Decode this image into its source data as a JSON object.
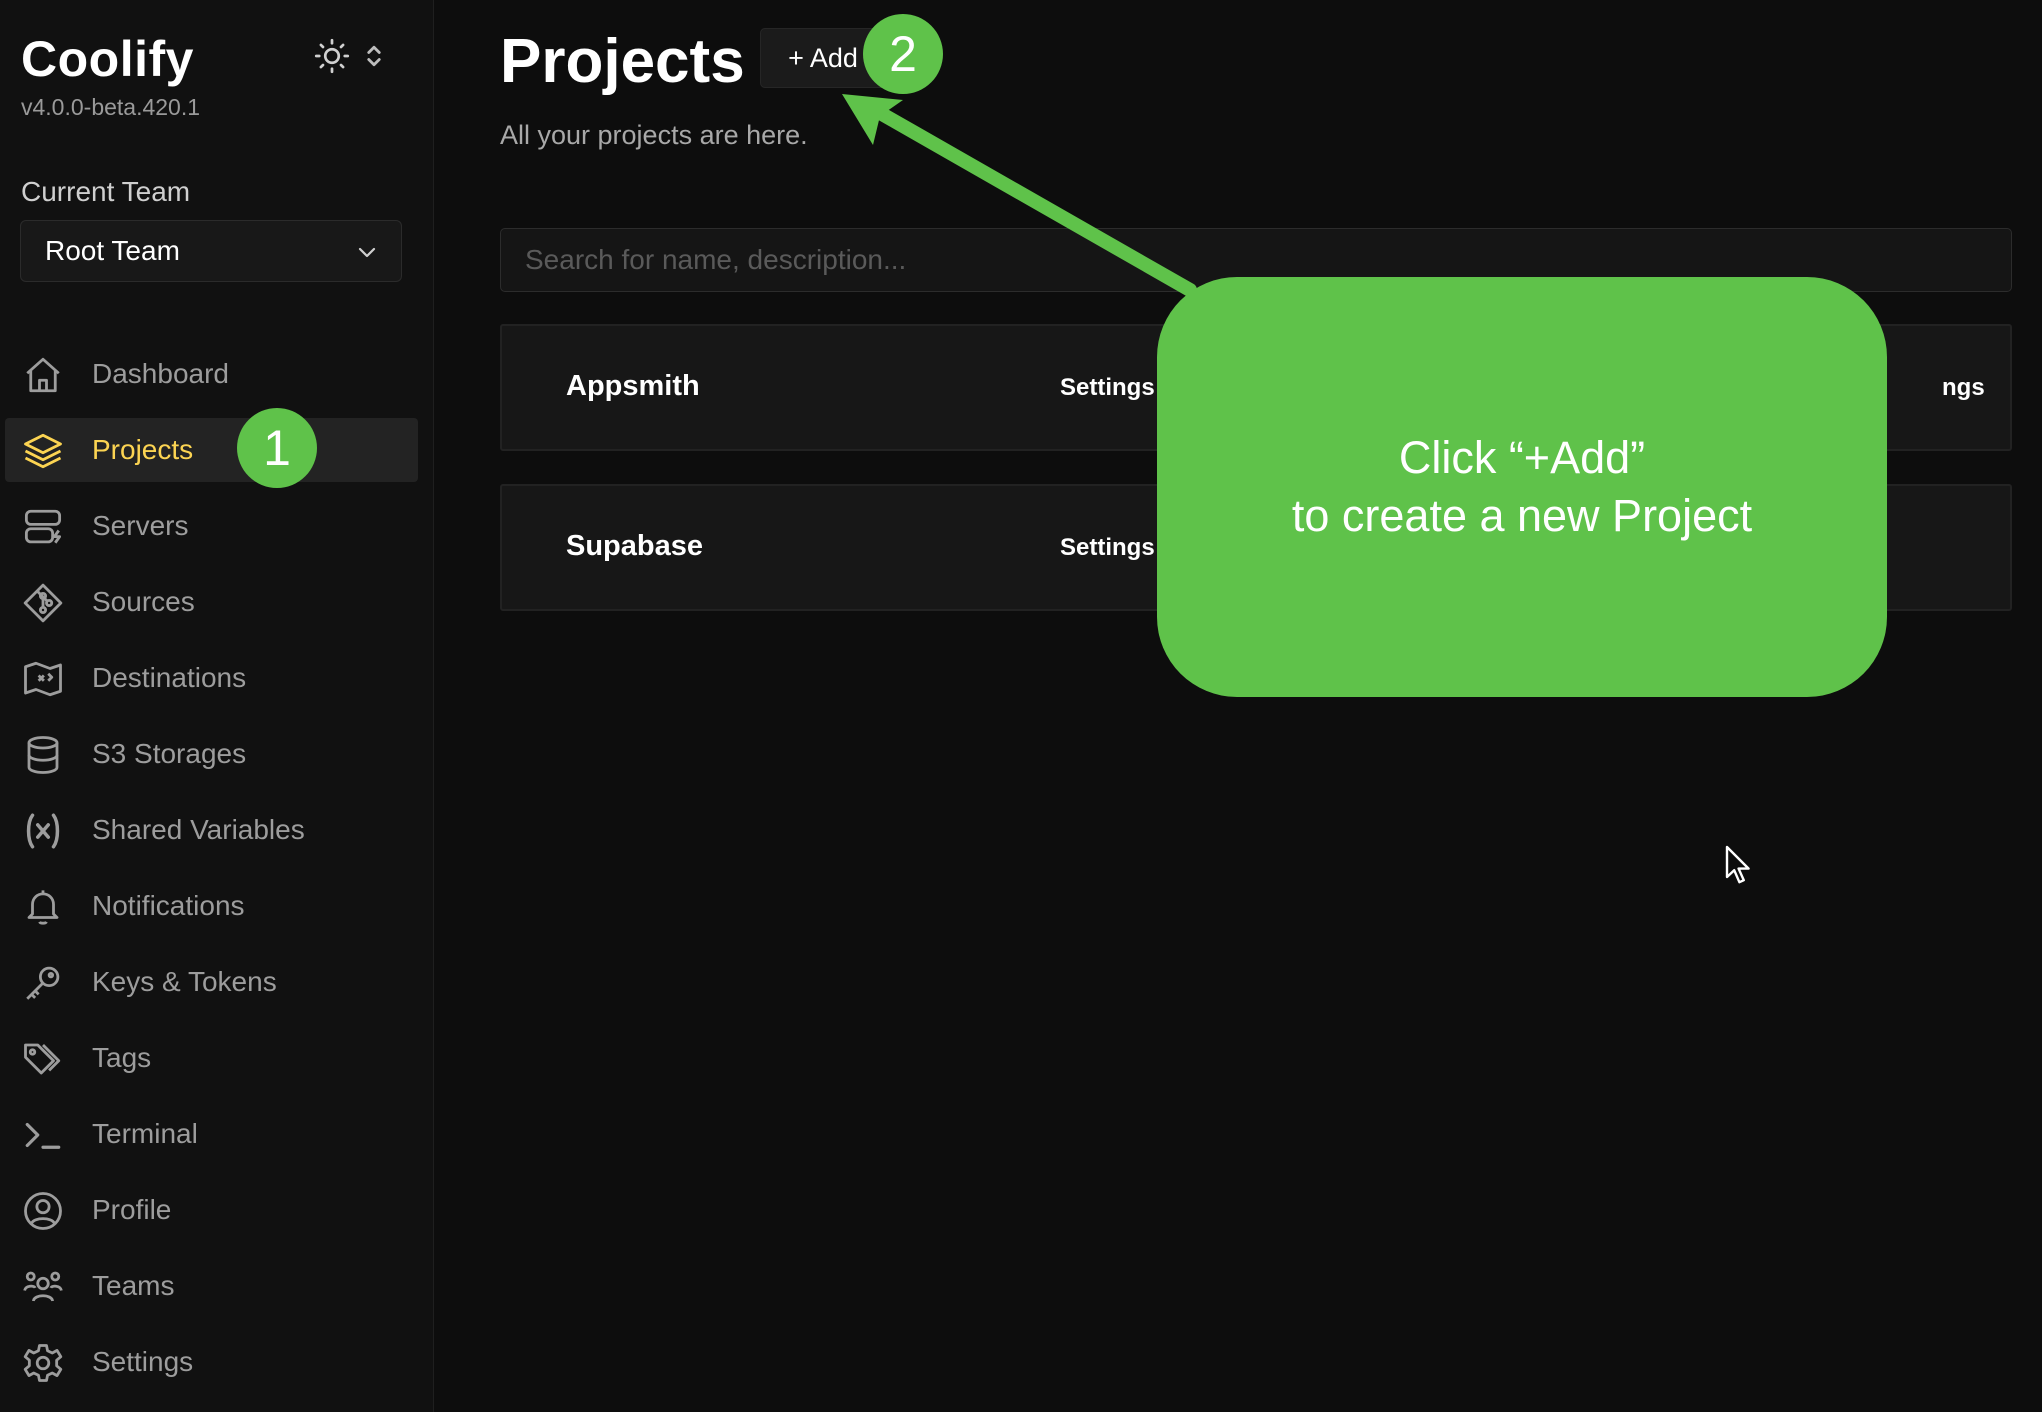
{
  "sidebar": {
    "brand": "Coolify",
    "version": "v4.0.0-beta.420.1",
    "current_team_label": "Current Team",
    "team_selected": "Root Team",
    "items": [
      {
        "label": "Dashboard",
        "icon": "home-icon"
      },
      {
        "label": "Projects",
        "icon": "layers-icon",
        "active": true
      },
      {
        "label": "Servers",
        "icon": "server-icon"
      },
      {
        "label": "Sources",
        "icon": "git-icon"
      },
      {
        "label": "Destinations",
        "icon": "map-icon"
      },
      {
        "label": "S3 Storages",
        "icon": "database-icon"
      },
      {
        "label": "Shared Variables",
        "icon": "variable-icon"
      },
      {
        "label": "Notifications",
        "icon": "bell-icon"
      },
      {
        "label": "Keys & Tokens",
        "icon": "key-icon"
      },
      {
        "label": "Tags",
        "icon": "tag-icon"
      },
      {
        "label": "Terminal",
        "icon": "terminal-icon"
      },
      {
        "label": "Profile",
        "icon": "user-circle-icon"
      },
      {
        "label": "Teams",
        "icon": "users-icon"
      },
      {
        "label": "Settings",
        "icon": "gear-icon"
      }
    ]
  },
  "main": {
    "title": "Projects",
    "add_label": "+ Add",
    "subtitle": "All your projects are here.",
    "search_placeholder": "Search for name, description...",
    "projects": [
      {
        "name": "Appsmith",
        "settings": "Settings",
        "settings_right": "ngs"
      },
      {
        "name": "Supabase",
        "settings": "Settings"
      }
    ]
  },
  "annotations": {
    "badge1": "1",
    "badge2": "2",
    "callout_line1": "Click “+Add”",
    "callout_line2": "to create a new Project",
    "color": "#5fc24a"
  },
  "colors": {
    "accent": "#fcd452",
    "background": "#0d0d0d",
    "sidebar": "#111111"
  }
}
